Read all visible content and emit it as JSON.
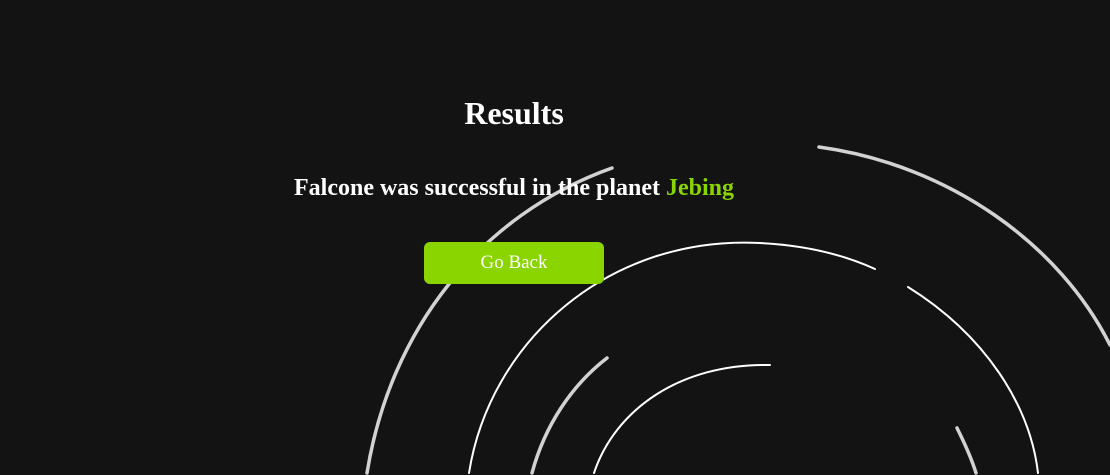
{
  "results": {
    "title": "Results",
    "message_prefix": "Falcone was successful in the planet ",
    "planet_name": "Jebing",
    "planet_color": "#8ad400"
  },
  "actions": {
    "go_back_label": "Go Back",
    "accent_color": "#8ad400"
  },
  "theme": {
    "background": "#131313",
    "text_color": "#ffffff",
    "ring_color": "#ffffff"
  }
}
